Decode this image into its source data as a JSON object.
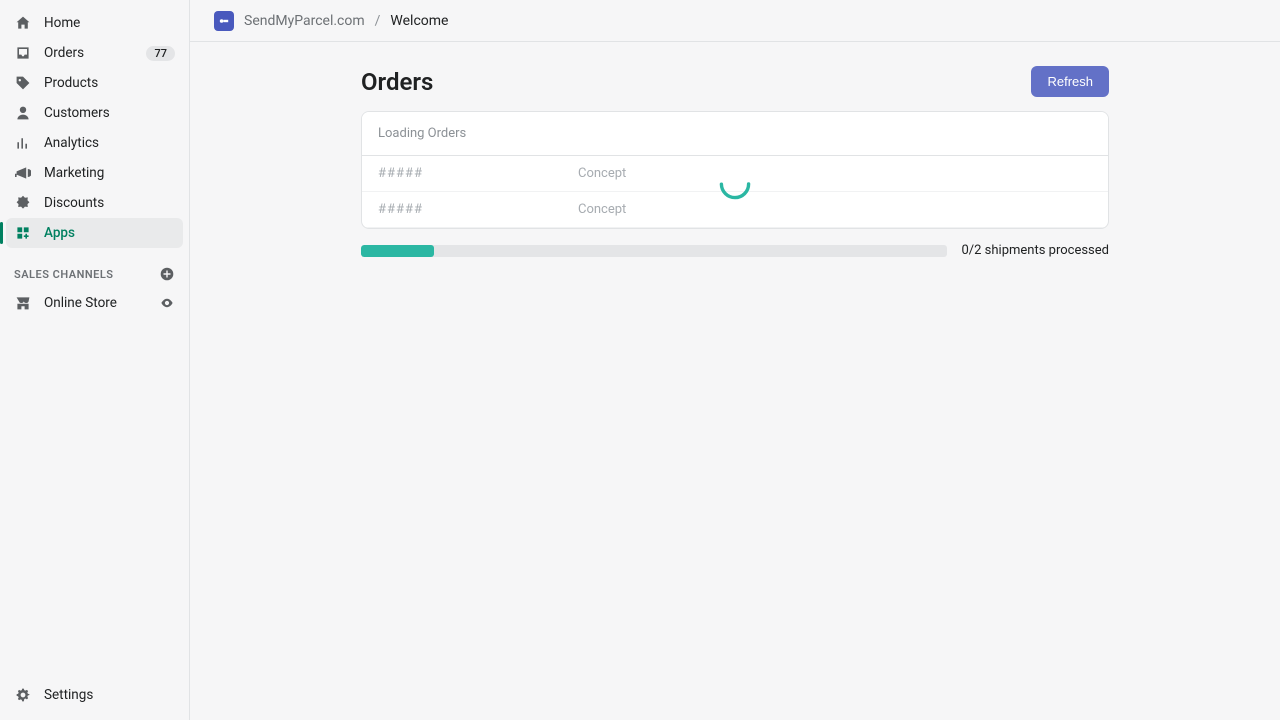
{
  "sidebar": {
    "items": [
      {
        "label": "Home"
      },
      {
        "label": "Orders",
        "badge": "77"
      },
      {
        "label": "Products"
      },
      {
        "label": "Customers"
      },
      {
        "label": "Analytics"
      },
      {
        "label": "Marketing"
      },
      {
        "label": "Discounts"
      },
      {
        "label": "Apps"
      }
    ],
    "channels_heading": "Sales Channels",
    "channels": [
      {
        "label": "Online Store"
      }
    ],
    "settings_label": "Settings"
  },
  "breadcrumb": {
    "app": "SendMyParcel.com",
    "sep": "/",
    "page": "Welcome"
  },
  "page": {
    "title": "Orders",
    "refresh_label": "Refresh",
    "loading_label": "Loading Orders",
    "rows": [
      {
        "id": "#####",
        "status": "Concept"
      },
      {
        "id": "#####",
        "status": "Concept"
      }
    ],
    "progress_label": "0/2 shipments processed",
    "progress_percent": 12.5
  },
  "colors": {
    "accent": "#008060",
    "primary_button": "#6371c7",
    "teal": "#2bb7a3"
  }
}
